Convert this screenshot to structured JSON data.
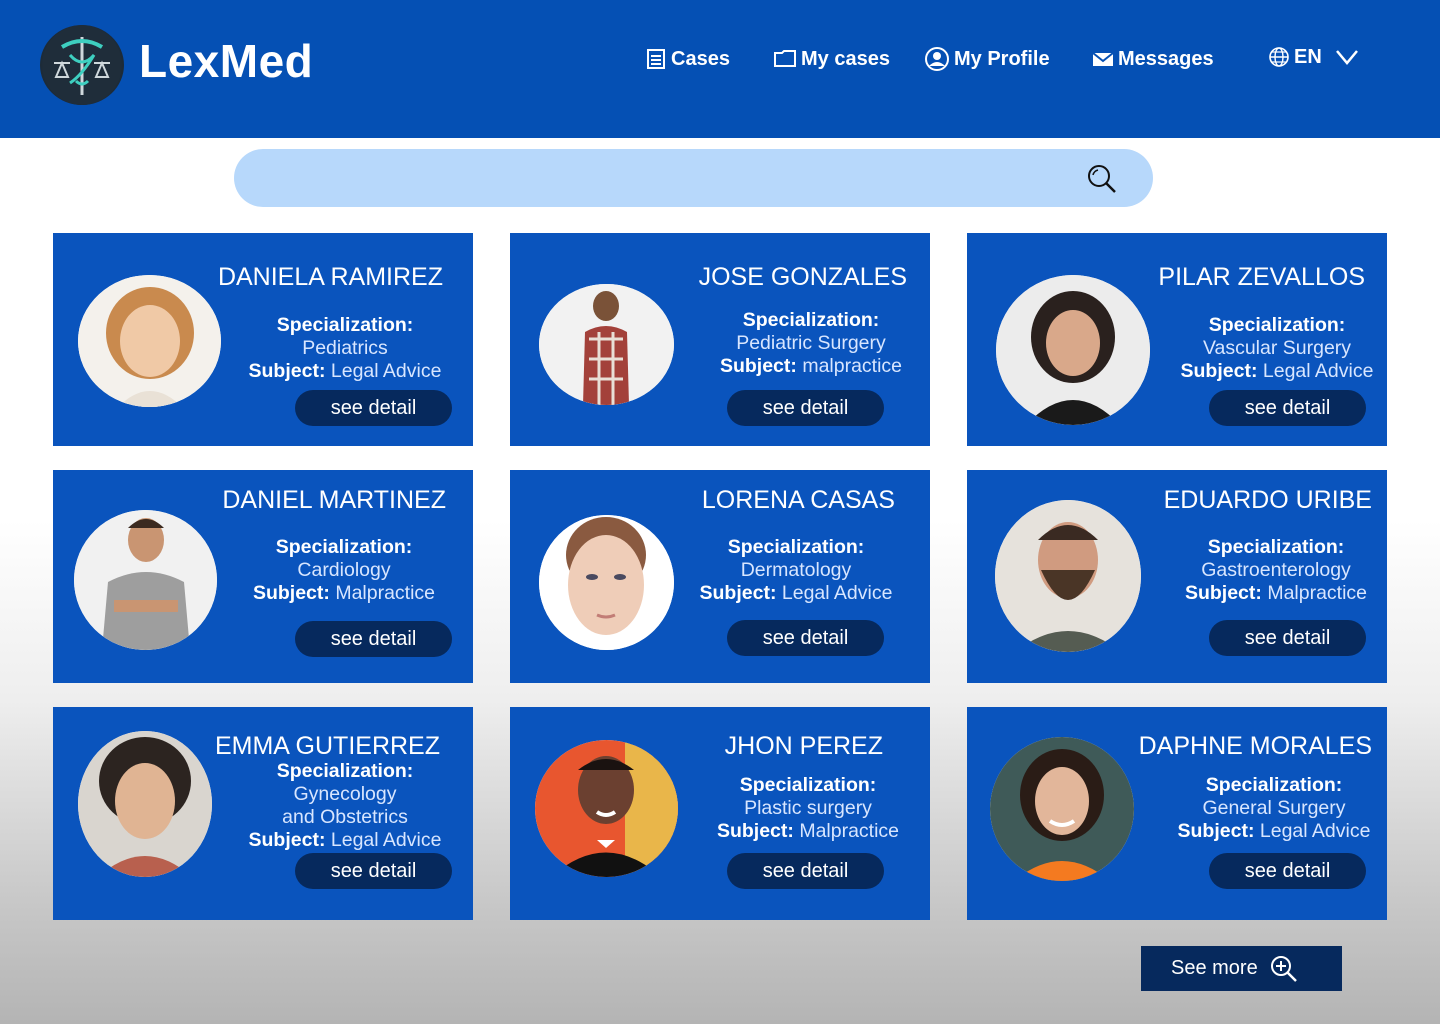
{
  "header": {
    "brand": "LexMed",
    "nav": [
      {
        "label": "Cases",
        "icon": "document-list-icon"
      },
      {
        "label": "My cases",
        "icon": "folder-icon"
      },
      {
        "label": "My Profile",
        "icon": "user-circle-icon"
      },
      {
        "label": "Messages",
        "icon": "envelope-icon"
      }
    ],
    "language": "EN"
  },
  "search": {
    "placeholder": ""
  },
  "cards": [
    {
      "name": "DANIELA RAMIREZ",
      "spec_label": "Specialization:",
      "specialization": "Pediatrics",
      "subject_label": "Subject:",
      "subject": "Legal Advice",
      "button": "see detail"
    },
    {
      "name": "JOSE GONZALES",
      "spec_label": "Specialization:",
      "specialization": "Pediatric Surgery",
      "subject_label": "Subject:",
      "subject": "malpractice",
      "button": "see detail"
    },
    {
      "name": "PILAR ZEVALLOS",
      "spec_label": "Specialization:",
      "specialization": "Vascular Surgery",
      "subject_label": "Subject:",
      "subject": "Legal Advice",
      "button": "see detail"
    },
    {
      "name": "DANIEL MARTINEZ",
      "spec_label": "Specialization:",
      "specialization": "Cardiology",
      "subject_label": "Subject:",
      "subject": "Malpractice",
      "button": "see detail"
    },
    {
      "name": "LORENA CASAS",
      "spec_label": "Specialization:",
      "specialization": "Dermatology",
      "subject_label": "Subject:",
      "subject": "Legal Advice",
      "button": "see detail"
    },
    {
      "name": "EDUARDO URIBE",
      "spec_label": "Specialization:",
      "specialization": "Gastroenterology",
      "subject_label": "Subject:",
      "subject": "Malpractice",
      "button": "see detail"
    },
    {
      "name": "EMMA GUTIERREZ",
      "spec_label": "Specialization:",
      "specialization": "Gynecology and Obstetrics",
      "subject_label": "Subject:",
      "subject": "Legal Advice",
      "button": "see detail"
    },
    {
      "name": "JHON PEREZ",
      "spec_label": "Specialization:",
      "specialization": "Plastic surgery",
      "subject_label": "Subject:",
      "subject": "Malpractice",
      "button": "see detail"
    },
    {
      "name": "DAPHNE MORALES",
      "spec_label": "Specialization:",
      "specialization": "General Surgery",
      "subject_label": "Subject:",
      "subject": "Legal Advice",
      "button": "see detail"
    }
  ],
  "see_more": "See more",
  "colors": {
    "primary": "#0550b4",
    "card": "#0a54bd",
    "button": "#06295d",
    "search": "#b7d8fb"
  }
}
